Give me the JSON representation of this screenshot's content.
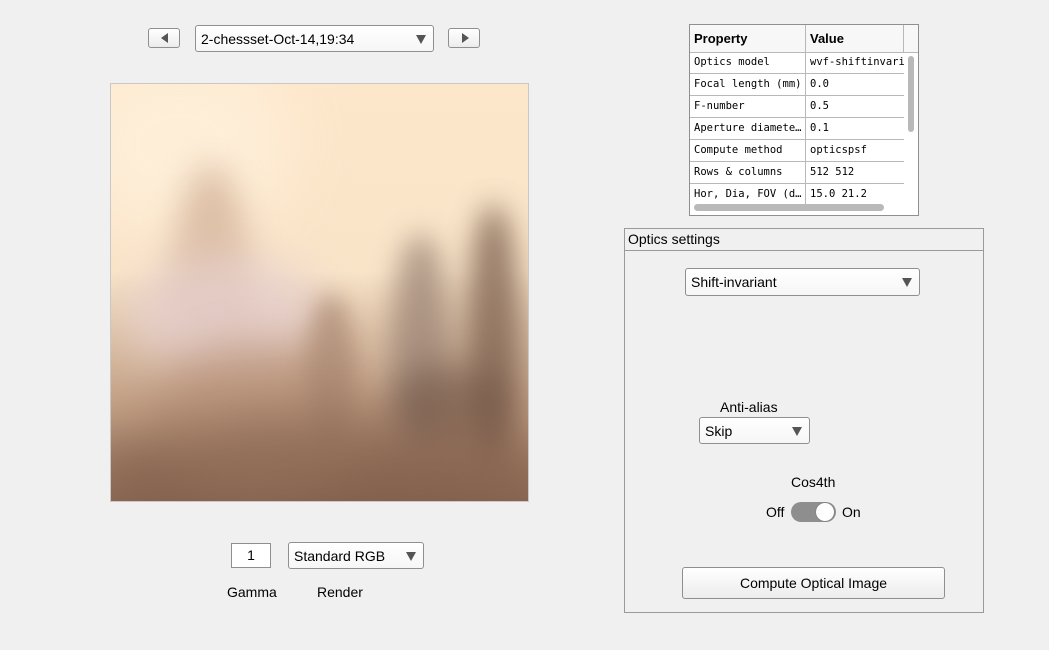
{
  "scene_selector": {
    "prev_icon": "triangle-left-icon",
    "next_icon": "triangle-right-icon",
    "selected": "2-chessset-Oct-14,19:34"
  },
  "property_table": {
    "headers": [
      "Property",
      "Value"
    ],
    "rows": [
      {
        "property": "Optics model",
        "value": "wvf-shiftinvariant"
      },
      {
        "property": "Focal length (mm)",
        "value": "0.0"
      },
      {
        "property": "F-number",
        "value": "0.5"
      },
      {
        "property": "Aperture diameter (mm)",
        "value": "0.1"
      },
      {
        "property": "Compute method",
        "value": "opticspsf"
      },
      {
        "property": "Rows & columns",
        "value": "512 512"
      },
      {
        "property": "Hor, Dia, FOV (deg)",
        "value": "15.0 21.2"
      }
    ]
  },
  "display": {
    "gamma_value": "1",
    "render_selected": "Standard RGB",
    "gamma_label": "Gamma",
    "render_label": "Render"
  },
  "optics_settings": {
    "title": "Optics settings",
    "model_selected": "Shift-invariant",
    "anti_alias_label": "Anti-alias",
    "anti_alias_selected": "Skip",
    "cos4th_label": "Cos4th",
    "cos4th_off_label": "Off",
    "cos4th_on_label": "On",
    "cos4th_state": "on",
    "compute_button_label": "Compute Optical Image"
  },
  "colors": {
    "background": "#f0f0f0",
    "toggle_track": "#8e8e8e"
  }
}
